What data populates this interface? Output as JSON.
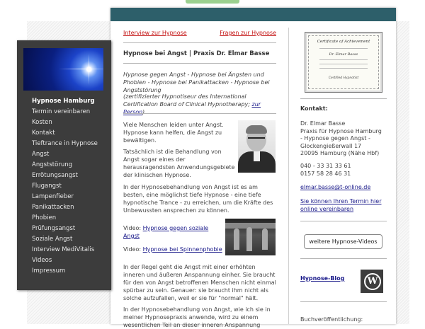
{
  "sidebar": {
    "items": [
      {
        "label": "Hypnose Hamburg",
        "active": true
      },
      {
        "label": "Termin vereinbaren"
      },
      {
        "label": "Kosten"
      },
      {
        "label": "Kontakt"
      },
      {
        "label": "Tieftrance in Hypnose"
      },
      {
        "label": "Angst"
      },
      {
        "label": "Angststörung"
      },
      {
        "label": "Errötungsangst"
      },
      {
        "label": "Flugangst"
      },
      {
        "label": "Lampenfieber"
      },
      {
        "label": "Panikattacken"
      },
      {
        "label": "Phobien"
      },
      {
        "label": "Prüfungsangst"
      },
      {
        "label": "Soziale Angst"
      },
      {
        "label": "Interview MediVitalis"
      },
      {
        "label": "Videos"
      },
      {
        "label": "Impressum"
      }
    ]
  },
  "main": {
    "link_left": "Interview zur Hypnose",
    "link_right": "Fragen zur Hypnose",
    "heading": "Hypnose bei Angst | Praxis Dr. Elmar Basse",
    "intro": "Hypnose gegen Angst - Hypnose bei Ängsten und Phobien - Hypnose bei Panikattacken - Hypnose bei Angststörung",
    "cert_note_prefix": "(zertifizierter Hypnotiseur des International Certification Board of Clinical Hypnotherapy; ",
    "cert_note_link": "zur Person",
    "cert_note_suffix": ")",
    "p1": "Viele Menschen leiden unter Angst. Hypnose kann helfen, die Angst zu bewältigen.",
    "p2": "Tatsächlich ist die Behandlung von Angst sogar eines der herausragendsten Anwendungsgebiete der klinischen Hypnose.",
    "p3": "In der Hypnosebehandlung von Angst ist es am besten, eine möglichst tiefe Hypnose - eine tiefe hypnotische Trance - zu erreichen, um die Kräfte des Unbewussten ansprechen zu können.",
    "video1_label": "Video: ",
    "video1_link": "Hypnose gegen soziale Angst",
    "video2_label": "Video: ",
    "video2_link": "Hypnose bei Spinnenphobie",
    "p4": "In der Regel geht die Angst mit einer erhöhten inneren und äußeren Anspannung einher. Sie braucht für den von Angst betroffenen Menschen nicht einmal spürbar zu sein. Genauer: sie braucht ihm nicht als solche aufzufallen, weil er sie für \"normal\" hält.",
    "p5": "In der Hypnosebehandlung von Angst, wie ich sie in meiner Hypnosepraxis anwende, wird zu einem wesentlichen Teil an dieser inneren Anspannung"
  },
  "right": {
    "cert_title": "Certificate of Achievement",
    "cert_name": "Dr. Elmar Basse",
    "cert_sub": "Certified Hypnotist",
    "contact_heading": "Kontakt:",
    "address": [
      "Dr. Elmar Basse",
      "Praxis für Hypnose Hamburg",
      "- Hypnose gegen Angst -",
      "Glockengießerwall 17",
      "20095 Hamburg (Nähe Hbf)"
    ],
    "phones": [
      "040 - 33 31 33 61",
      "0157 58 28 46 31"
    ],
    "email": "elmar.basse@t-online.de",
    "appointment_link": "Sie können Ihren Termin hier online vereinbaren",
    "videos_button": "weitere Hypnose-Videos",
    "blog_link": "Hypnose-Blog",
    "book_label": "Buchveröffentlichung:"
  }
}
